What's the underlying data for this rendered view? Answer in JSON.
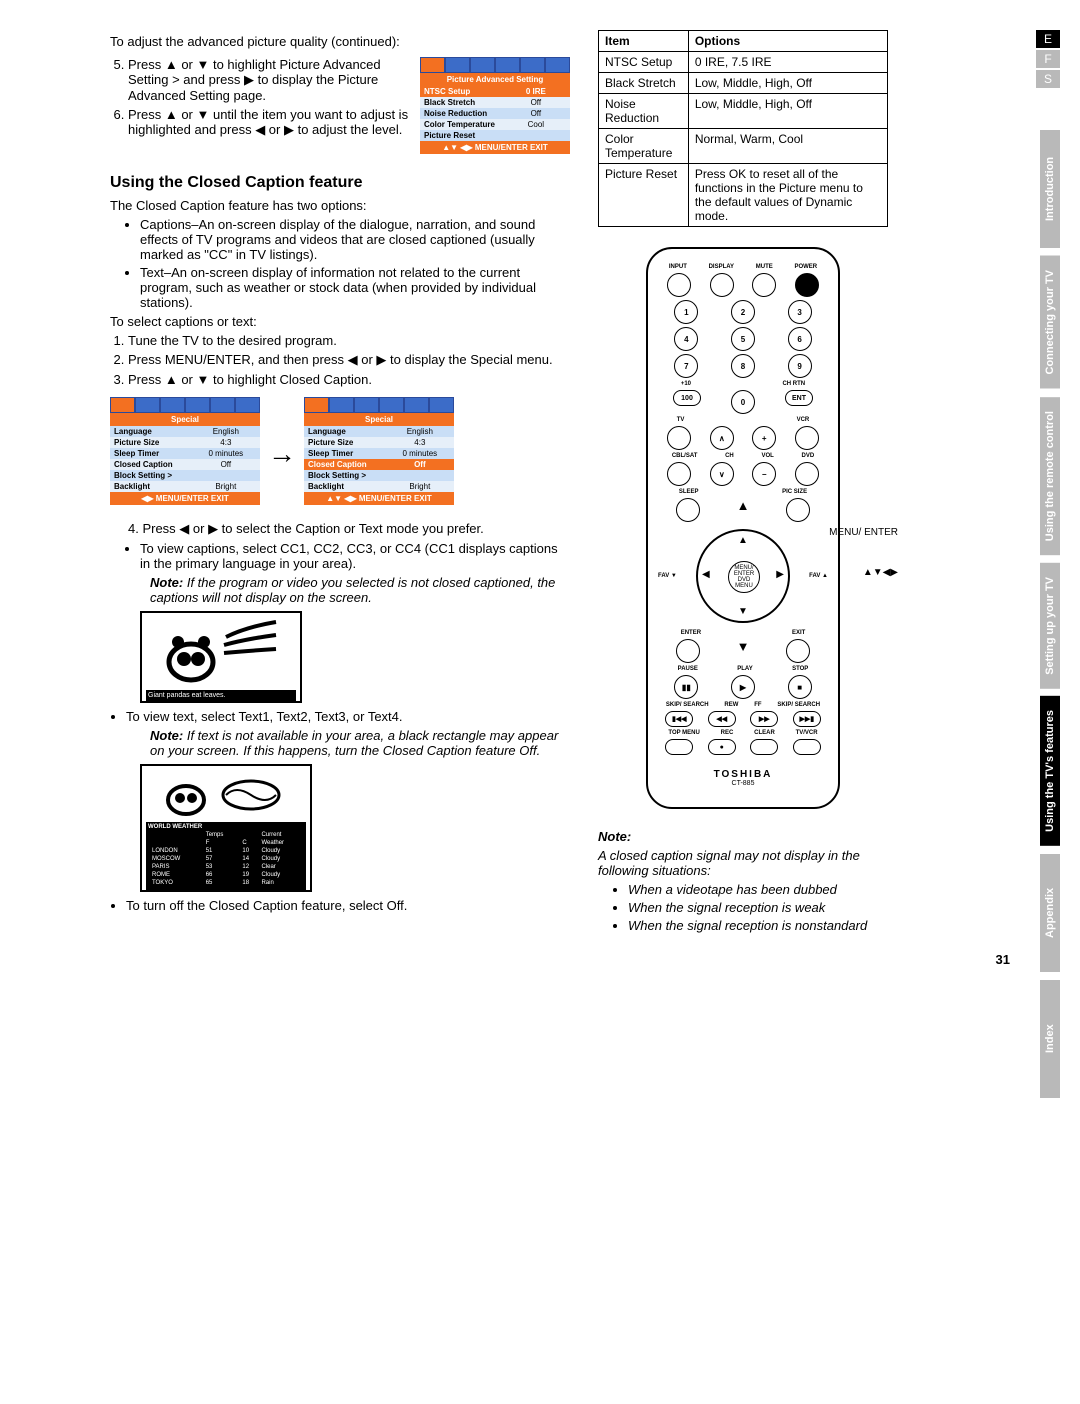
{
  "lang_tabs": [
    "E",
    "F",
    "S"
  ],
  "lang_active": 0,
  "side_tabs": [
    "Introduction",
    "Connecting your TV",
    "Using the remote control",
    "Setting up your TV",
    "Using the TV's features",
    "Appendix",
    "Index"
  ],
  "side_active": 4,
  "intro": "To adjust the advanced picture quality (continued):",
  "step5": "Press ▲ or ▼ to highlight Picture Advanced Setting > and press ▶ to display the Picture Advanced Setting page.",
  "step6": "Press ▲ or ▼ until the item you want to adjust is highlighted and press ◀ or ▶ to adjust the level.",
  "osd_adv": {
    "title": "Picture Advanced Setting",
    "rows": [
      [
        "NTSC Setup",
        "0 IRE",
        true
      ],
      [
        "Black Stretch",
        "Off",
        false
      ],
      [
        "Noise Reduction",
        "Off",
        false
      ],
      [
        "Color Temperature",
        "Cool",
        false
      ],
      [
        "Picture Reset",
        "",
        false
      ]
    ],
    "foot": "▲▼ ◀▶ MENU/ENTER EXIT"
  },
  "h_cc": "Using the Closed Caption feature",
  "cc_intro": "The Closed Caption feature has two options:",
  "cc_b1": "Captions–An on-screen display of the dialogue, narration, and sound effects of TV programs and videos that are closed captioned (usually marked as \"CC\" in TV listings).",
  "cc_b2": "Text–An on-screen display of information not related to the current program, such as weather or stock data (when provided by individual stations).",
  "sel_intro": "To select captions or text:",
  "s1": "Tune the TV to the desired program.",
  "s2": "Press MENU/ENTER, and then press ◀ or ▶ to display the Special menu.",
  "s3": "Press ▲ or ▼ to highlight Closed Caption.",
  "osd_special": {
    "title": "Special",
    "rows": [
      [
        "Language",
        "English"
      ],
      [
        "Picture Size",
        "4:3"
      ],
      [
        "Sleep Timer",
        "0 minutes"
      ],
      [
        "Closed Caption",
        "Off"
      ],
      [
        "Block Setting >",
        ""
      ],
      [
        "Backlight",
        "Bright"
      ]
    ],
    "foot": "◀▶ MENU/ENTER EXIT"
  },
  "osd_special2_foot": "▲▼ ◀▶ MENU/ENTER EXIT",
  "s4": "4. Press ◀ or ▶ to select the Caption or Text mode you prefer.",
  "s4b": "To view captions, select CC1, CC2, CC3, or CC4 (CC1 displays captions in the primary language in your area).",
  "s4note_label": "Note:",
  "s4note": "If the program or video you selected is not closed captioned, the captions will not display on the screen.",
  "panda_cap": "Giant pandas eat leaves.",
  "text_bullet": "To view text, select Text1, Text2, Text3, or Text4.",
  "text_note": "If text is not available in your area, a black rectangle may appear on your screen. If this happens, turn the Closed Caption feature Off.",
  "weather": {
    "title": "WORLD WEATHER",
    "cols": [
      "Temps",
      "",
      "Current"
    ],
    "sub": [
      "",
      "F",
      "C",
      "Weather"
    ],
    "rows": [
      [
        "LONDON",
        "51",
        "10",
        "Cloudy"
      ],
      [
        "MOSCOW",
        "57",
        "14",
        "Cloudy"
      ],
      [
        "PARIS",
        "53",
        "12",
        "Clear"
      ],
      [
        "ROME",
        "66",
        "19",
        "Cloudy"
      ],
      [
        "TOKYO",
        "65",
        "18",
        "Rain"
      ]
    ]
  },
  "turnoff": "To turn off the Closed Caption feature, select Off.",
  "opt_table": {
    "head": [
      "Item",
      "Options"
    ],
    "rows": [
      [
        "NTSC Setup",
        "0 IRE, 7.5 IRE"
      ],
      [
        "Black Stretch",
        "Low, Middle, High, Off"
      ],
      [
        "Noise Reduction",
        "Low, Middle, High, Off"
      ],
      [
        "Color Temperature",
        "Normal, Warm, Cool"
      ],
      [
        "Picture Reset",
        "Press OK to reset all of the functions in the Picture menu to the default values of Dynamic mode."
      ]
    ]
  },
  "remote": {
    "top": [
      "INPUT",
      "DISPLAY",
      "MUTE",
      "POWER"
    ],
    "nums": [
      "1",
      "2",
      "3",
      "4",
      "5",
      "6",
      "7",
      "8",
      "9"
    ],
    "row4": [
      "100",
      "0",
      "ENT"
    ],
    "row4_top": [
      "+10",
      "",
      "CH RTN"
    ],
    "mode_top": [
      "TV",
      "",
      "VCR"
    ],
    "mode_bot": [
      "CBL/SAT",
      "CH",
      "VOL",
      "DVD"
    ],
    "sleep": "SLEEP",
    "picsize": "PIC SIZE",
    "fav_l": "FAV ▼",
    "fav_r": "FAV ▲",
    "center": "MENU/\nENTER\nDVD MENU",
    "enter": "ENTER",
    "exit": "EXIT",
    "play_row": [
      "PAUSE",
      "PLAY",
      "STOP"
    ],
    "play_syms": [
      "▮▮",
      "▶",
      "■"
    ],
    "skip_row": [
      "SKIP/\nSEARCH",
      "REW",
      "FF",
      "SKIP/\nSEARCH"
    ],
    "skip_syms": [
      "▮◀◀",
      "◀◀",
      "▶▶",
      "▶▶▮"
    ],
    "bottom": [
      "TOP MENU",
      "REC",
      "CLEAR",
      "TV/VCR"
    ],
    "brand": "TOSHIBA",
    "model": "CT-885",
    "callout1": "MENU/\nENTER",
    "callout2": "▲▼◀▶"
  },
  "rnote_label": "Note:",
  "rnote": "A closed caption signal may not display in the following situations:",
  "rnotes": [
    "When a videotape has been dubbed",
    "When the signal reception is weak",
    "When the signal reception is nonstandard"
  ],
  "page": "31"
}
